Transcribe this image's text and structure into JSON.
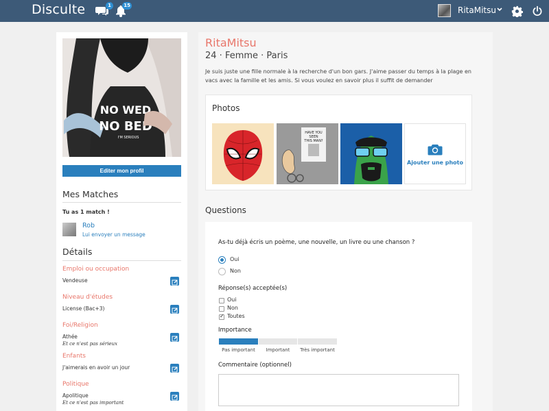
{
  "app": {
    "name": "Disculte"
  },
  "topbar": {
    "messages_badge": "1",
    "notifications_badge": "15",
    "username": "RitaMitsu"
  },
  "sidebar": {
    "edit_profile_label": "Editer mon profil",
    "matches": {
      "title": "Mes Matches",
      "count_text": "Tu as 1 match !",
      "items": [
        {
          "name": "Rob",
          "action": "Lui envoyer un message"
        }
      ]
    },
    "details": {
      "title": "Détails",
      "items": [
        {
          "label": "Emploi ou occupation",
          "value": "Vendeuse",
          "note": ""
        },
        {
          "label": "Niveau d'études",
          "value": "License (Bac+3)",
          "note": ""
        },
        {
          "label": "Foi/Religion",
          "value": "Athée",
          "note": "Et ce n'est pas sérieux"
        },
        {
          "label": "Enfants",
          "value": "J'aimerais en avoir un jour",
          "note": ""
        },
        {
          "label": "Politique",
          "value": "Apolitique",
          "note": "Et ce n'est pas important"
        }
      ]
    }
  },
  "profile": {
    "username": "RitaMitsu",
    "subline": "24 · Femme · Paris",
    "bio": "Je suis juste une fille normale à la recherche d'un bon gars. J'aime passer du temps à la plage en vacs avec la famille et les amis. Si vous voulez en savoir plus il suffit de demander",
    "shirt_text": [
      "NO WED",
      "NO BED",
      "I'M SERIOUS"
    ]
  },
  "photos": {
    "title": "Photos",
    "add_label": "Ajouter une photo",
    "poster_text": [
      "HAVE YOU",
      "SEEN",
      "THIS MAN?"
    ]
  },
  "questions": {
    "title": "Questions",
    "question": "As-tu déjà écris un poème, une nouvelle, un livre ou une chanson ?",
    "answers": [
      {
        "label": "Oui",
        "selected": true
      },
      {
        "label": "Non",
        "selected": false
      }
    ],
    "accepted_title": "Réponse(s) acceptée(s)",
    "accepted": [
      {
        "label": "Oui",
        "checked": false
      },
      {
        "label": "Non",
        "checked": false
      },
      {
        "label": "Toutes",
        "checked": true
      }
    ],
    "importance_title": "Importance",
    "importance": [
      {
        "label": "Pas important",
        "selected": true
      },
      {
        "label": "Important",
        "selected": false
      },
      {
        "label": "Très important",
        "selected": false
      }
    ],
    "comment_title": "Commentaire (optionnel)",
    "comment_value": ""
  },
  "colors": {
    "topbar": "#3d5a78",
    "accent_blue": "#2a7fbd",
    "accent_red": "#e8766a"
  }
}
